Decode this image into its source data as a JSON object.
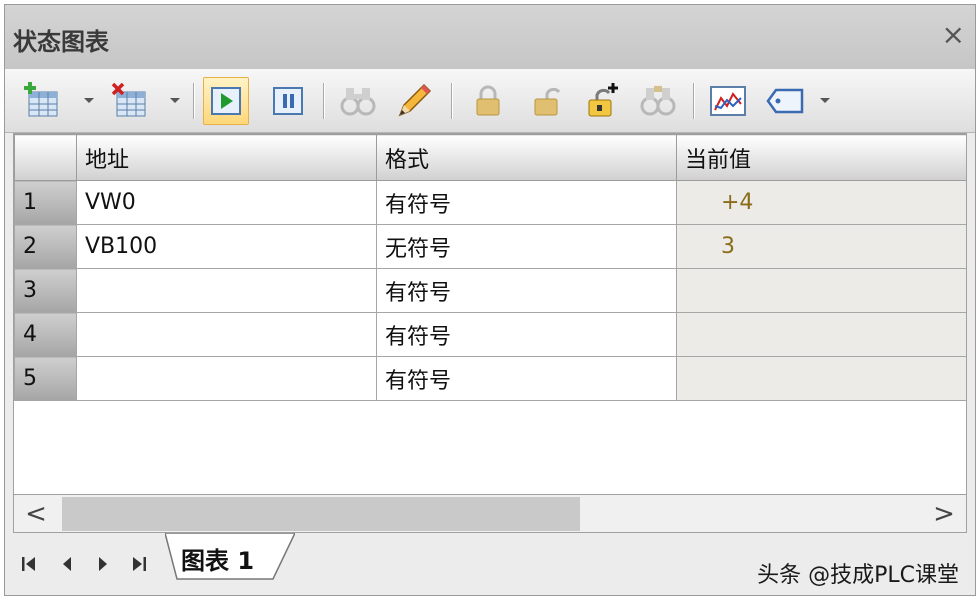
{
  "window": {
    "title": "状态图表",
    "close_label": "×"
  },
  "toolbar": {
    "buttons": [
      {
        "name": "insert-row",
        "icon": "table-add-icon"
      },
      {
        "name": "delete-row",
        "icon": "table-delete-icon"
      },
      {
        "name": "chart-status",
        "icon": "play-icon",
        "active": true
      },
      {
        "name": "pause",
        "icon": "pause-icon"
      },
      {
        "name": "read",
        "icon": "binoculars-icon"
      },
      {
        "name": "write",
        "icon": "pencil-icon"
      },
      {
        "name": "force",
        "icon": "lock-icon"
      },
      {
        "name": "unforce",
        "icon": "unlock-icon"
      },
      {
        "name": "unforce-all",
        "icon": "unlock-all-icon"
      },
      {
        "name": "read-forced",
        "icon": "binoculars-lock-icon"
      },
      {
        "name": "trend-view",
        "icon": "trend-chart-icon"
      },
      {
        "name": "tag",
        "icon": "tag-icon"
      }
    ]
  },
  "table": {
    "headers": [
      "",
      "地址",
      "格式",
      "当前值"
    ],
    "rows": [
      {
        "num": "1",
        "address": "VW0",
        "format": "有符号",
        "value": "+4"
      },
      {
        "num": "2",
        "address": "VB100",
        "format": "无符号",
        "value": "3"
      },
      {
        "num": "3",
        "address": "",
        "format": "有符号",
        "value": ""
      },
      {
        "num": "4",
        "address": "",
        "format": "有符号",
        "value": ""
      },
      {
        "num": "5",
        "address": "",
        "format": "有符号",
        "value": ""
      }
    ]
  },
  "scroll": {
    "left": "<",
    "right": ">"
  },
  "bottom": {
    "sheet_tab": "图表 1",
    "watermark": "头条 @技成PLC课堂"
  },
  "colors": {
    "value_text": "#8a6d1a",
    "active_button": "#ffd77a"
  }
}
